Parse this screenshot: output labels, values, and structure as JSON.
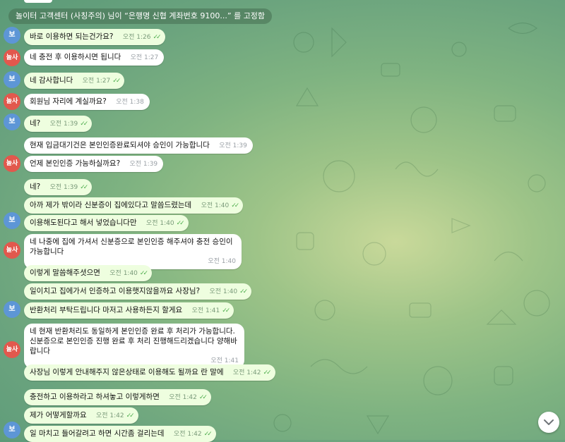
{
  "pinned": "놀이터 고객센터 (사칭주의) 님이 “은행명 신협 계좌번호 9100...” 를 고정함",
  "avatars": {
    "bo": "보",
    "nongsa": "놀사"
  },
  "messages": [
    {
      "text": "바로 이용하면 되는건가요?",
      "time": "오전 1:26",
      "read": true
    },
    {
      "text": "네 충전 후 이용하시면 됩니다",
      "time": "오전 1:27",
      "read": false
    },
    {
      "text": "네 감사합니다",
      "time": "오전 1:27",
      "read": true
    },
    {
      "text": "회원님 자리에 계실까요?",
      "time": "오전 1:38",
      "read": false
    },
    {
      "text": "네?",
      "time": "오전 1:39",
      "read": true
    },
    {
      "text": "현재 입금대기건은 본인인증완료되셔야 승인이 가능합니다",
      "time": "오전 1:39",
      "read": false
    },
    {
      "text": "언제 본인인증 가능하실까요?",
      "time": "오전 1:39",
      "read": false
    },
    {
      "text": "네?",
      "time": "오전 1:39",
      "read": true
    },
    {
      "text": "아까 제가 밖이라 신분증이 집에있다고 말씀드렸는데",
      "time": "오전 1:40",
      "read": true
    },
    {
      "text": "이용해도된다고 해서 넣었습니다만",
      "time": "오전 1:40",
      "read": true
    },
    {
      "text": "네 나중에 집에 가셔서 신분증으로 본인인증 해주셔야 충전 승인이 가능합니다",
      "time": "오전 1:40",
      "read": false
    },
    {
      "text": "이렇게 말씀해주셧으면",
      "time": "오전 1:40",
      "read": true
    },
    {
      "text": "일이치고 집에가서 인증하고 이용햇지않을까요 사장님?",
      "time": "오전 1:40",
      "read": true
    },
    {
      "text": "반환처리 부탁드립니다 마저고 사용하든지 할게요",
      "time": "오전 1:41",
      "read": true
    },
    {
      "text": "네 현재 반환처리도 동일하게 본인인증 완료 후 처리가 가능합니다. 신분증으로 본인인증 진행 완료 후 처리 진행해드리겠습니다 양해바랍니다",
      "time": "오전 1:41",
      "read": false
    },
    {
      "text": "사장님 이렇게 안내해주지 않은상태로 이용해도 될까요 란 말에",
      "time": "오전 1:42",
      "read": true
    },
    {
      "text": "충전하고 이용하라고 하셔놓고 이렇게하면",
      "time": "오전 1:42",
      "read": true
    },
    {
      "text": "제가 어떻게할까요",
      "time": "오전 1:42",
      "read": true
    },
    {
      "text": "일 마치고 들어갈려고 하면 시간좀 걸리는데",
      "time": "오전 1:42",
      "read": true
    }
  ]
}
